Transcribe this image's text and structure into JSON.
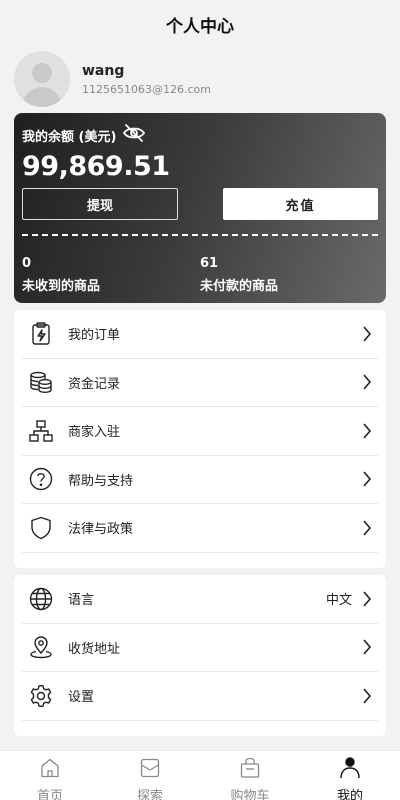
{
  "header": {
    "title": "个人中心"
  },
  "profile": {
    "name": "wang",
    "email": "1125651063@126.com"
  },
  "balance": {
    "label": "我的余额 (美元)",
    "amount": "99,869.51",
    "withdraw_label": "提现",
    "recharge_label": "充值",
    "stats": [
      {
        "num": "0",
        "label": "未收到的商品"
      },
      {
        "num": "61",
        "label": "未付款的商品"
      }
    ]
  },
  "menu1": [
    {
      "label": "我的订单",
      "icon": "order-icon"
    },
    {
      "label": "资金记录",
      "icon": "coins-icon"
    },
    {
      "label": "商家入驻",
      "icon": "org-chart-icon"
    },
    {
      "label": "帮助与支持",
      "icon": "help-icon"
    },
    {
      "label": "法律与政策",
      "icon": "shield-icon"
    }
  ],
  "menu2": [
    {
      "label": "语言",
      "value": "中文",
      "icon": "globe-icon"
    },
    {
      "label": "收货地址",
      "icon": "location-icon"
    },
    {
      "label": "设置",
      "icon": "gear-icon"
    }
  ],
  "tabbar": [
    {
      "label": "首页",
      "icon": "home-icon"
    },
    {
      "label": "探索",
      "icon": "explore-icon"
    },
    {
      "label": "购物车",
      "icon": "cart-icon"
    },
    {
      "label": "我的",
      "icon": "user-icon",
      "active": true
    }
  ]
}
